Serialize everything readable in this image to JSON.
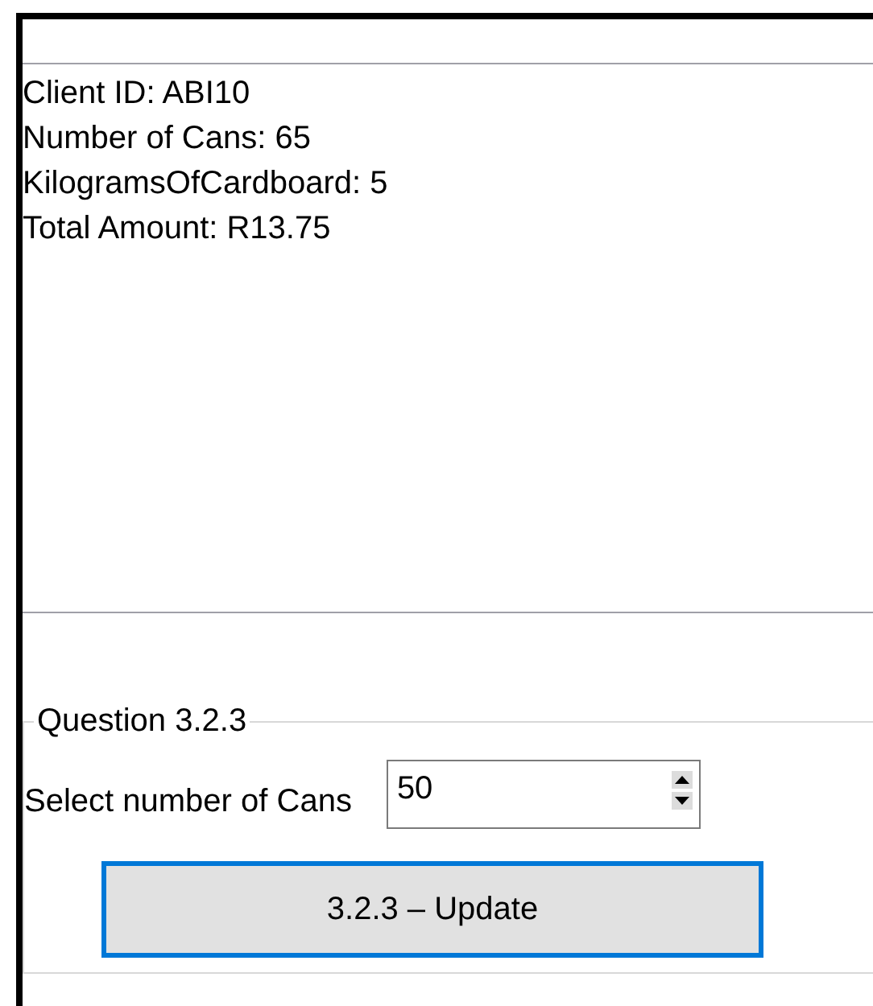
{
  "output_lines": [
    "Client ID: ABI10",
    "Number of Cans: 65",
    "KilogramsOfCardboard: 5",
    "Total Amount: R13.75"
  ],
  "group": {
    "title": "Question 3.2.3",
    "label": "Select number of Cans",
    "spinner_value": "50",
    "button": {
      "label": "3.2.3 – Update",
      "focused": true
    }
  }
}
